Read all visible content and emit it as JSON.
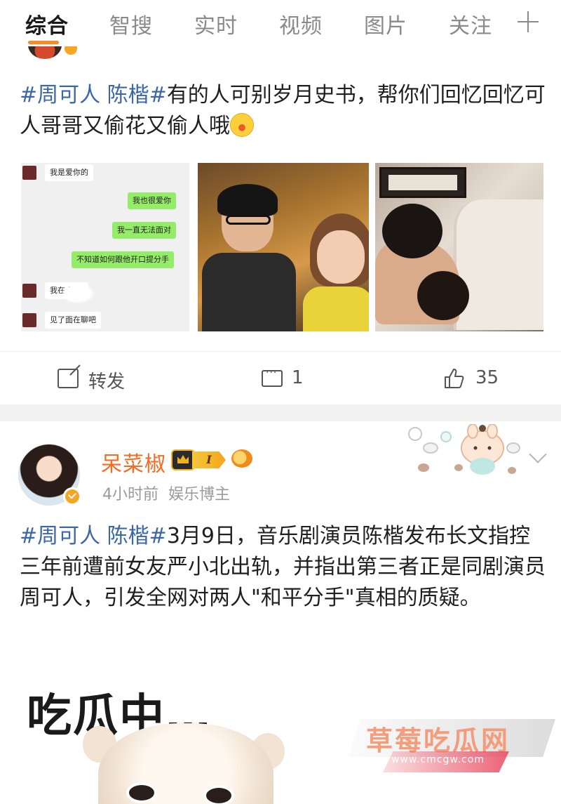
{
  "tabs": [
    {
      "label": "综合",
      "active": true
    },
    {
      "label": "智搜"
    },
    {
      "label": "实时"
    },
    {
      "label": "视频"
    },
    {
      "label": "图片"
    },
    {
      "label": "关注"
    }
  ],
  "accent_color": "#f78b26",
  "post1": {
    "topic": "#周可人 陈楷#",
    "text": "有的人可别岁月史书，帮你们回忆回忆可人哥哥又偷花又偷人哦",
    "chat": [
      {
        "side": "left",
        "text": "我是爱你的"
      },
      {
        "side": "right",
        "text": "我也很爱你"
      },
      {
        "side": "right",
        "text": "我一直无法面对"
      },
      {
        "side": "right",
        "text": "不知道如何跟他开口提分手"
      },
      {
        "side": "left",
        "text": "我在        酒店"
      },
      {
        "side": "left",
        "text": "见了面在聊吧"
      }
    ],
    "actions": {
      "share_label": "转发",
      "comment_count": "1",
      "like_count": "35"
    }
  },
  "post2": {
    "username": "呆菜椒",
    "level": "I",
    "time": "4小时前",
    "identity": "娱乐博主",
    "topic": "#周可人 陈楷#",
    "text": "3月9日，音乐剧演员陈楷发布长文指控三年前遭前女友严小北出轨，并指出第三者正是同剧演员周可人，引发全网对两人\"和平分手\"真相的质疑。",
    "sticker_text": "吃瓜中…"
  },
  "watermark": {
    "title": "草莓吃瓜网",
    "url": "www.cmcgw.com"
  }
}
